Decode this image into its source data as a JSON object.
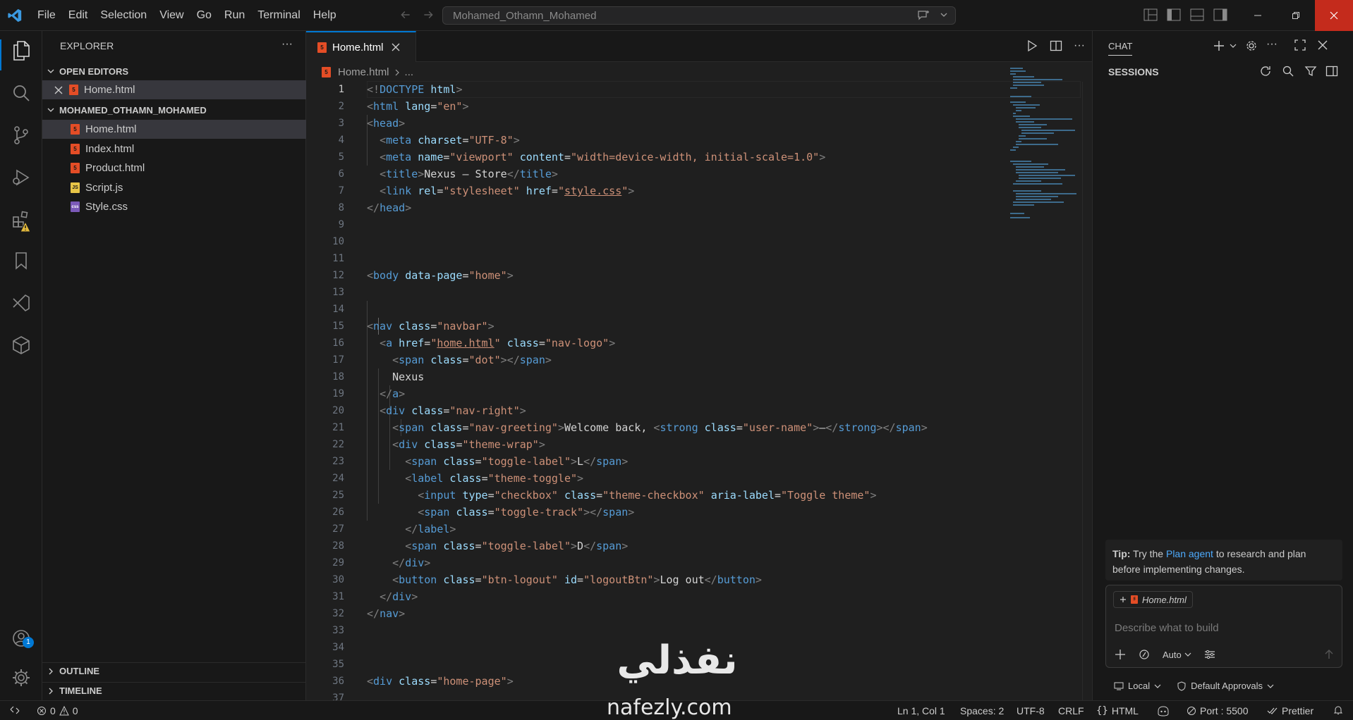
{
  "titlebar": {
    "menu": [
      "File",
      "Edit",
      "Selection",
      "View",
      "Go",
      "Run",
      "Terminal",
      "Help"
    ],
    "search_text": "Mohamed_Othamn_Mohamed"
  },
  "sidebar": {
    "title": "EXPLORER",
    "open_editors_label": "OPEN EDITORS",
    "open_editors": [
      "Home.html"
    ],
    "folder_label": "MOHAMED_OTHAMN_MOHAMED",
    "files": [
      {
        "name": "Home.html",
        "type": "html"
      },
      {
        "name": "Index.html",
        "type": "html"
      },
      {
        "name": "Product.html",
        "type": "html"
      },
      {
        "name": "Script.js",
        "type": "js"
      },
      {
        "name": "Style.css",
        "type": "css"
      }
    ],
    "outline_label": "OUTLINE",
    "timeline_label": "TIMELINE",
    "account_badge": "1"
  },
  "editor": {
    "tab_label": "Home.html",
    "breadcrumb_file": "Home.html",
    "breadcrumb_more": "...",
    "line_numbers": [
      "1",
      "2",
      "3",
      "4",
      "5",
      "6",
      "7",
      "8",
      "9",
      "10",
      "11",
      "12",
      "13",
      "14",
      "15",
      "16",
      "17",
      "18",
      "19",
      "20",
      "21",
      "22",
      "23",
      "24",
      "25",
      "26",
      "27",
      "28",
      "29",
      "30",
      "31",
      "32",
      "33",
      "34",
      "35",
      "36",
      "37"
    ]
  },
  "chat": {
    "title": "CHAT",
    "sessions_label": "SESSIONS",
    "tip_bold": "Tip:",
    "tip_pre": "Try the",
    "tip_link": "Plan agent",
    "tip_post": "to research and plan before implementing changes.",
    "context_file": "Home.html",
    "input_placeholder": "Describe what to build",
    "mode": "Auto",
    "location": "Local",
    "approvals": "Default Approvals"
  },
  "statusbar": {
    "errors": "0",
    "warnings": "0",
    "position": "Ln 1, Col 1",
    "spaces": "Spaces: 2",
    "encoding": "UTF-8",
    "eol": "CRLF",
    "language": "HTML",
    "port": "Port : 5500",
    "formatter": "Prettier"
  },
  "watermark": {
    "arabic": "نفذلي",
    "latin": "nafezly.com"
  }
}
